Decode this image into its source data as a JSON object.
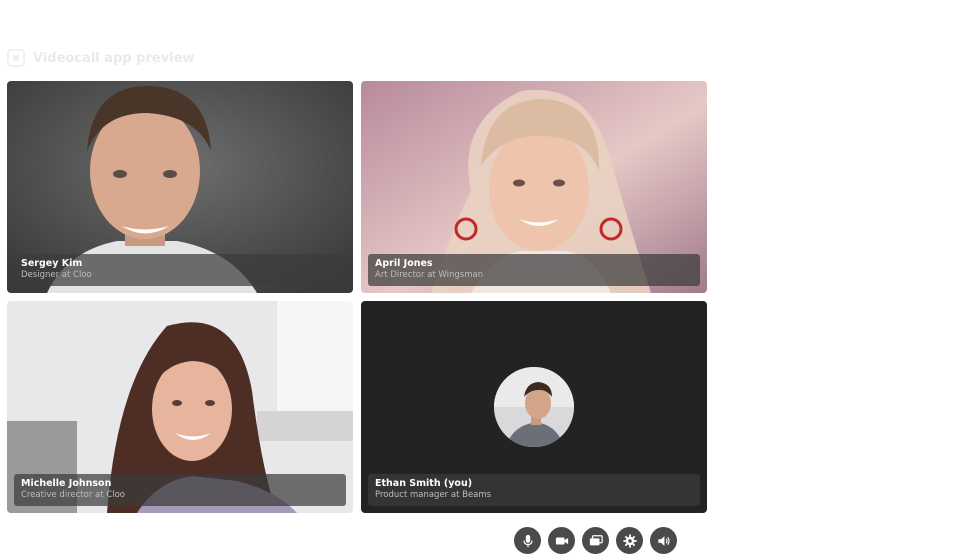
{
  "app": {
    "title": "Videocall app preview"
  },
  "participants": [
    {
      "name": "Sergey Kim",
      "role": "Designer at Cloo"
    },
    {
      "name": "April Jones",
      "role": "Art Director at Wingsman"
    },
    {
      "name": "Michelle Johnson",
      "role": "Creative director at Cloo"
    },
    {
      "name": "Ethan Smith (you)",
      "role": "Product manager at Beams"
    }
  ],
  "controls": [
    {
      "icon": "microphone-icon"
    },
    {
      "icon": "camera-icon"
    },
    {
      "icon": "screen-share-icon"
    },
    {
      "icon": "gear-icon"
    },
    {
      "icon": "speaker-icon"
    }
  ],
  "colors": {
    "background": "#ffffff",
    "self_tile": "#232323",
    "control_button": "#4a4a4a",
    "caption_bg": "rgba(60,60,60,0.72)"
  }
}
